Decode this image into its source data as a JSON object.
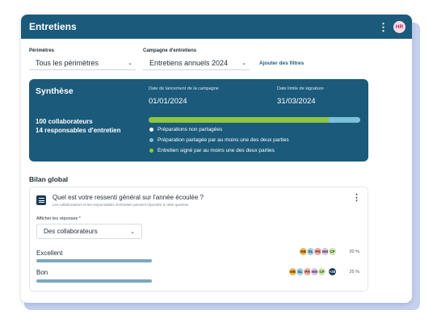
{
  "header": {
    "title": "Entretiens",
    "avatar_initials": "HR"
  },
  "filters": {
    "perimetres_label": "Périmètres",
    "perimetres_value": "Tous les périmètres",
    "campagne_label": "Campagne d'entretiens",
    "campagne_value": "Entretiens annuels 2024",
    "add_filters": "Ajouter des filtres"
  },
  "synthese": {
    "title": "Synthèse",
    "launch_label": "Date de lancement de la campagne",
    "launch_date": "01/01/2024",
    "deadline_label": "Date limite de signature",
    "deadline_date": "31/03/2024",
    "collaborateurs": "100 collaborateurs",
    "responsables": "14 responsables d'entretien",
    "progress_signed_fraction": 0.85,
    "legend": [
      {
        "label": "Préparations non partagées",
        "color": "#ffffff"
      },
      {
        "label": "Préparation partagée par au moins une des deux parties",
        "color": "#7cc1da"
      },
      {
        "label": "Entretien signé par au moins une des deux parties",
        "color": "#8dc63f"
      }
    ]
  },
  "bilan": {
    "title": "Bilan global",
    "question": "Quel est votre ressenti général sur l'année écoulée ?",
    "question_sub": "Les collaborateurs et les responsables d'entretien peuvent répondre à cette question",
    "show_label": "Afficher les réponses *",
    "show_value": "Des collaborateurs",
    "answers": [
      {
        "label": "Excellent",
        "percent": "20 %",
        "avatars": [
          {
            "initials": "MB",
            "color": "#f6b43c"
          },
          {
            "initials": "SL",
            "color": "#9fd0e6"
          },
          {
            "initials": "PH",
            "color": "#f2a99c"
          },
          {
            "initials": "NM",
            "color": "#d8c4e6"
          },
          {
            "initials": "CF",
            "color": "#c8e6a6"
          }
        ]
      },
      {
        "label": "Bon",
        "percent": "25 %",
        "avatars": [
          {
            "initials": "MB",
            "color": "#f6b43c"
          },
          {
            "initials": "SL",
            "color": "#9fd0e6"
          },
          {
            "initials": "PH",
            "color": "#f2a99c"
          },
          {
            "initials": "NM",
            "color": "#d8c4e6"
          },
          {
            "initials": "CF",
            "color": "#c8e6a6"
          },
          {
            "initials": "+20",
            "color": "#1b3a54"
          }
        ]
      }
    ]
  }
}
